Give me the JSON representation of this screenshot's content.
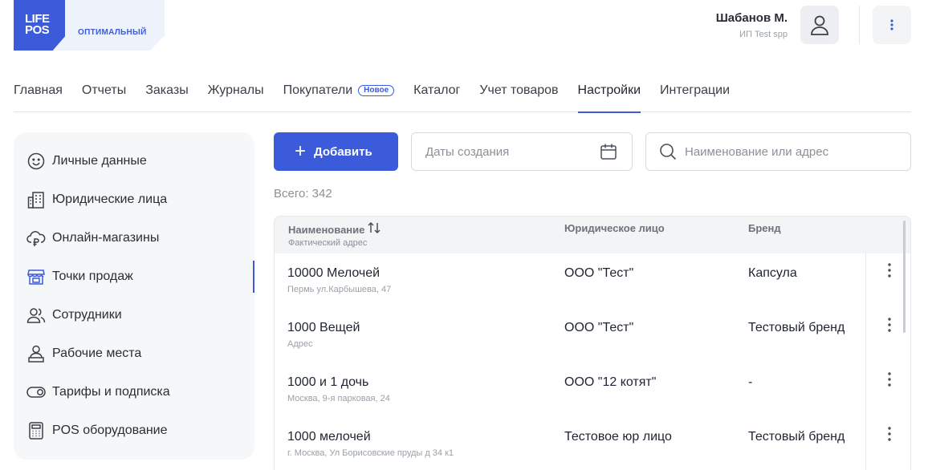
{
  "brand": {
    "logo_line1": "LIFE",
    "logo_line2": "POS",
    "plan": "ОПТИМАЛЬНЫЙ"
  },
  "user": {
    "name": "Шабанов М.",
    "org": "ИП Test spp"
  },
  "nav": {
    "items": [
      {
        "label": "Главная"
      },
      {
        "label": "Отчеты"
      },
      {
        "label": "Заказы"
      },
      {
        "label": "Журналы"
      },
      {
        "label": "Покупатели",
        "badge": "Новое"
      },
      {
        "label": "Каталог"
      },
      {
        "label": "Учет товаров"
      },
      {
        "label": "Настройки",
        "active": true
      },
      {
        "label": "Интеграции"
      }
    ]
  },
  "sidebar": {
    "items": [
      {
        "label": "Личные данные",
        "icon": "smile-icon"
      },
      {
        "label": "Юридические лица",
        "icon": "building-icon"
      },
      {
        "label": "Онлайн-магазины",
        "icon": "cloud-ruble-icon"
      },
      {
        "label": "Точки продаж",
        "icon": "store-icon",
        "active": true
      },
      {
        "label": "Сотрудники",
        "icon": "users-icon"
      },
      {
        "label": "Рабочие места",
        "icon": "workplace-icon"
      },
      {
        "label": "Тарифы и подписка",
        "icon": "toggle-icon"
      },
      {
        "label": "POS оборудование",
        "icon": "calculator-icon"
      }
    ]
  },
  "toolbar": {
    "add_label": "Добавить",
    "date_placeholder": "Даты создания",
    "search_placeholder": "Наименование или адрес"
  },
  "total": "Всего: 342",
  "table": {
    "headers": {
      "name": "Наименование",
      "address": "Фактический адрес",
      "legal": "Юридическое лицо",
      "brand": "Бренд"
    },
    "rows": [
      {
        "name": "10000 Мелочей",
        "address": "Пермь ул.Карбышева, 47",
        "legal": "ООО \"Тест\"",
        "brand": "Капсула"
      },
      {
        "name": "1000 Вещей",
        "address": "Адрес",
        "legal": "ООО \"Тест\"",
        "brand": "Тестовый бренд"
      },
      {
        "name": "1000 и 1 дочь",
        "address": "Москва, 9-я парковая, 24",
        "legal": "ООО \"12 котят\"",
        "brand": "-"
      },
      {
        "name": "1000 мелочей",
        "address": "г. Москва, Ул Борисовские пруды д 34 к1",
        "legal": "Тестовое юр лицо",
        "brand": "Тестовый бренд"
      }
    ]
  },
  "colors": {
    "accent": "#3b5bdb",
    "sidebar_bg": "#f6f7f8",
    "header_bg": "#f3f4f6"
  }
}
